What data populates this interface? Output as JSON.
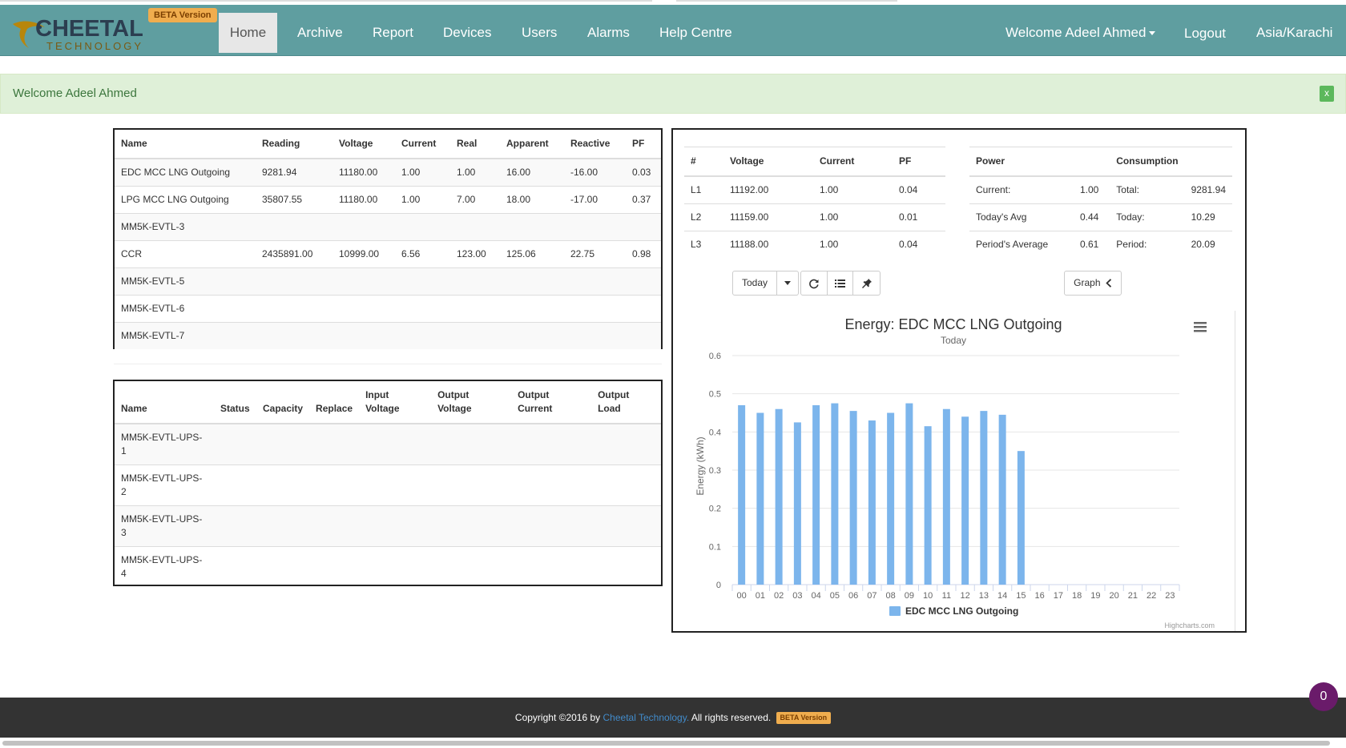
{
  "brand": {
    "name": "CHEETAL",
    "sub": "TECHNOLOGY",
    "beta": "BETA Version"
  },
  "nav": {
    "items": [
      "Home",
      "Archive",
      "Report",
      "Devices",
      "Users",
      "Alarms",
      "Help Centre"
    ],
    "welcome": "Welcome Adeel Ahmed",
    "logout": "Logout",
    "timezone": "Asia/Karachi"
  },
  "alert": {
    "text": "Welcome Adeel Ahmed",
    "close": "x"
  },
  "meters": {
    "headers": [
      "Name",
      "Reading",
      "Voltage",
      "Current",
      "Real",
      "Apparent",
      "Reactive",
      "PF"
    ],
    "rows": [
      [
        "EDC MCC LNG Outgoing",
        "9281.94",
        "11180.00",
        "1.00",
        "1.00",
        "16.00",
        "-16.00",
        "0.03"
      ],
      [
        "LPG MCC LNG Outgoing",
        "35807.55",
        "11180.00",
        "1.00",
        "7.00",
        "18.00",
        "-17.00",
        "0.37"
      ],
      [
        "MM5K-EVTL-3",
        "",
        "",
        "",
        "",
        "",
        "",
        ""
      ],
      [
        "CCR",
        "2435891.00",
        "10999.00",
        "6.56",
        "123.00",
        "125.06",
        "22.75",
        "0.98"
      ],
      [
        "MM5K-EVTL-5",
        "",
        "",
        "",
        "",
        "",
        "",
        ""
      ],
      [
        "MM5K-EVTL-6",
        "",
        "",
        "",
        "",
        "",
        "",
        ""
      ],
      [
        "MM5K-EVTL-7",
        "",
        "",
        "",
        "",
        "",
        "",
        ""
      ]
    ]
  },
  "ups": {
    "headers": [
      "Name",
      "Status",
      "Capacity",
      "Replace",
      "Input Voltage",
      "Output Voltage",
      "Output Current",
      "Output Load"
    ],
    "rows": [
      [
        "MM5K-EVTL-UPS-1"
      ],
      [
        "MM5K-EVTL-UPS-2"
      ],
      [
        "MM5K-EVTL-UPS-3"
      ],
      [
        "MM5K-EVTL-UPS-4"
      ]
    ]
  },
  "phases": {
    "headers": [
      "#",
      "Voltage",
      "Current",
      "PF"
    ],
    "rows": [
      [
        "L1",
        "11192.00",
        "1.00",
        "0.04"
      ],
      [
        "L2",
        "11159.00",
        "1.00",
        "0.01"
      ],
      [
        "L3",
        "11188.00",
        "1.00",
        "0.04"
      ]
    ]
  },
  "summary": {
    "headers": [
      "Power",
      "",
      "Consumption",
      ""
    ],
    "rows": [
      [
        "Current:",
        "1.00",
        "Total:",
        "9281.94"
      ],
      [
        "Today's Avg",
        "0.44",
        "Today:",
        "10.29"
      ],
      [
        "Period's Average",
        "0.61",
        "Period:",
        "20.09"
      ]
    ]
  },
  "controls": {
    "period": "Today",
    "graph": "Graph"
  },
  "chart_data": {
    "type": "bar",
    "title": "Energy: EDC MCC LNG Outgoing",
    "subtitle": "Today",
    "ylabel": "Energy (kWh)",
    "xlabel": "",
    "ylim": [
      0,
      0.6
    ],
    "yticks": [
      "0",
      "0.1",
      "0.2",
      "0.3",
      "0.4",
      "0.5",
      "0.6"
    ],
    "categories": [
      "00",
      "01",
      "02",
      "03",
      "04",
      "05",
      "06",
      "07",
      "08",
      "09",
      "10",
      "11",
      "12",
      "13",
      "14",
      "15",
      "16",
      "17",
      "18",
      "19",
      "20",
      "21",
      "22",
      "23"
    ],
    "series": [
      {
        "name": "EDC MCC LNG Outgoing",
        "values": [
          0.47,
          0.45,
          0.46,
          0.425,
          0.47,
          0.475,
          0.455,
          0.43,
          0.45,
          0.475,
          0.415,
          0.46,
          0.44,
          0.455,
          0.445,
          0.35,
          null,
          null,
          null,
          null,
          null,
          null,
          null,
          null
        ]
      }
    ],
    "grid": true,
    "legend": "bottom-center",
    "color": "#7cb5ec",
    "credits": "Highcharts.com"
  },
  "footer": {
    "copyright": "Copyright ©2016 by",
    "company": "Cheetal Technology.",
    "rights": "All rights reserved.",
    "beta": "BETA Version"
  },
  "bubble": "0"
}
